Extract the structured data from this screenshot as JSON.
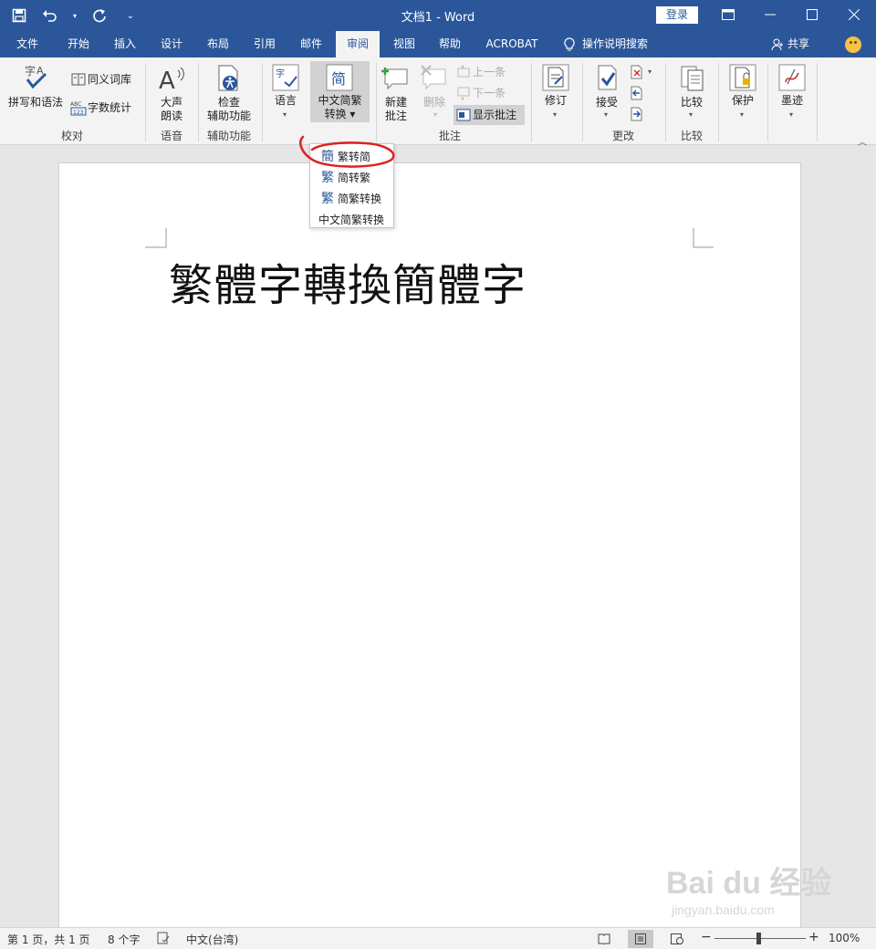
{
  "titlebar": {
    "title": "文档1  -  Word",
    "login": "登录"
  },
  "tabs": [
    {
      "label": "文件"
    },
    {
      "label": "开始"
    },
    {
      "label": "插入"
    },
    {
      "label": "设计"
    },
    {
      "label": "布局"
    },
    {
      "label": "引用"
    },
    {
      "label": "邮件"
    },
    {
      "label": "审阅",
      "active": true
    },
    {
      "label": "视图"
    },
    {
      "label": "帮助"
    },
    {
      "label": "ACROBAT"
    }
  ],
  "tell_me": "操作说明搜索",
  "share": "共享",
  "ribbon": {
    "proofing": {
      "spelling": "拼写和语法",
      "thesaurus": "同义词库",
      "wordcount": "字数统计",
      "group": "校对"
    },
    "speech": {
      "read_aloud_1": "大声",
      "read_aloud_2": "朗读",
      "group": "语音"
    },
    "accessibility": {
      "check_1": "检查",
      "check_2": "辅助功能",
      "group": "辅助功能"
    },
    "language": {
      "language": "语言"
    },
    "chinese": {
      "convert_1": "中文简繁",
      "convert_2": "转换"
    },
    "comments": {
      "new_1": "新建",
      "new_2": "批注",
      "delete": "删除",
      "prev": "上一条",
      "next": "下一条",
      "show": "显示批注",
      "group": "批注"
    },
    "tracking": {
      "track": "修订"
    },
    "changes": {
      "accept": "接受",
      "group": "更改"
    },
    "compare": {
      "compare": "比较",
      "group": "比较"
    },
    "protect": {
      "protect": "保护"
    },
    "ink": {
      "ink": "墨迹"
    }
  },
  "dropdown": {
    "items": [
      {
        "icon": "簡",
        "label": "繁转简"
      },
      {
        "icon": "繁",
        "label": "简转繁"
      },
      {
        "icon": "繁",
        "label": "简繁转换"
      },
      {
        "icon": "",
        "label": "中文简繁转换"
      }
    ]
  },
  "document": {
    "text": "繁體字轉換簡體字"
  },
  "watermark": {
    "main": "Bai  du 经验",
    "sub": "jingyan.baidu.com"
  },
  "statusbar": {
    "page": "第 1 页，共 1 页",
    "words": "8 个字",
    "language": "中文(台湾)",
    "zoom": "100%",
    "zoom_minus": "−",
    "zoom_plus": "+",
    "zoom_level": 1.0
  },
  "colors": {
    "accent": "#2b579a",
    "annotation": "#e02020"
  }
}
